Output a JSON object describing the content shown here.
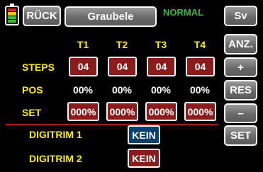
{
  "header": {
    "back_label": "RÜCK",
    "model_name": "Graubele",
    "mode_label": "NORMAL",
    "sv_label": "Sv"
  },
  "battery": {
    "cell_colors": [
      "#e8231e",
      "#f0c21c",
      "#3bbf2a",
      "#3bbf2a"
    ]
  },
  "sidebar": {
    "anz_label": "ANZ.",
    "plus_label": "+",
    "res_label": "RES",
    "minus_label": "–",
    "set_label": "SET"
  },
  "table": {
    "columns": [
      "T1",
      "T2",
      "T3",
      "T4"
    ],
    "steps": {
      "label": "STEPS",
      "values": [
        "04",
        "04",
        "04",
        "04"
      ]
    },
    "pos": {
      "label": "POS",
      "values": [
        "00%",
        "00%",
        "00%",
        "00%"
      ]
    },
    "set": {
      "label": "SET",
      "values": [
        "000%",
        "000%",
        "000%",
        "000%"
      ]
    }
  },
  "digitrim": {
    "row1": {
      "label": "DIGITRIM 1",
      "value": "KEIN"
    },
    "row2": {
      "label": "DIGITRIM 2",
      "value": "KEIN"
    }
  },
  "colors": {
    "accent_yellow": "#ffee00",
    "header_green": "#3fb43f",
    "button_red": "#8b1c1c",
    "button_blue": "#0a3f73",
    "separator_red": "#b01818"
  }
}
